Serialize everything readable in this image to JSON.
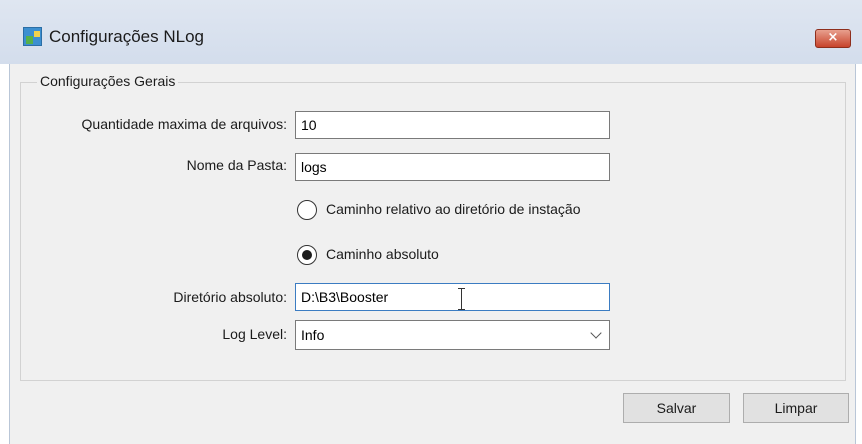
{
  "window": {
    "title": "Configurações NLog",
    "close_label": "×"
  },
  "group": {
    "title": "Configurações Gerais"
  },
  "fields": {
    "max_files": {
      "label": "Quantidade maxima de arquivos:",
      "value": "10"
    },
    "folder_name": {
      "label": "Nome da Pasta:",
      "value": "logs"
    },
    "path_mode": {
      "options": [
        {
          "label": "Caminho relativo ao diretório de instação",
          "selected": false
        },
        {
          "label": "Caminho absoluto",
          "selected": true
        }
      ]
    },
    "absolute_dir": {
      "label": "Diretório absoluto:",
      "value": "D:\\B3\\Booster"
    },
    "log_level": {
      "label": "Log Level:",
      "value": "Info"
    }
  },
  "buttons": {
    "save_label": "Salvar",
    "clear_label": "Limpar"
  },
  "colors": {
    "titlebar": "#d3ddec",
    "close_button": "#c7432b",
    "client_background": "#f0f0f0",
    "focus_border": "#3b7cc2"
  }
}
